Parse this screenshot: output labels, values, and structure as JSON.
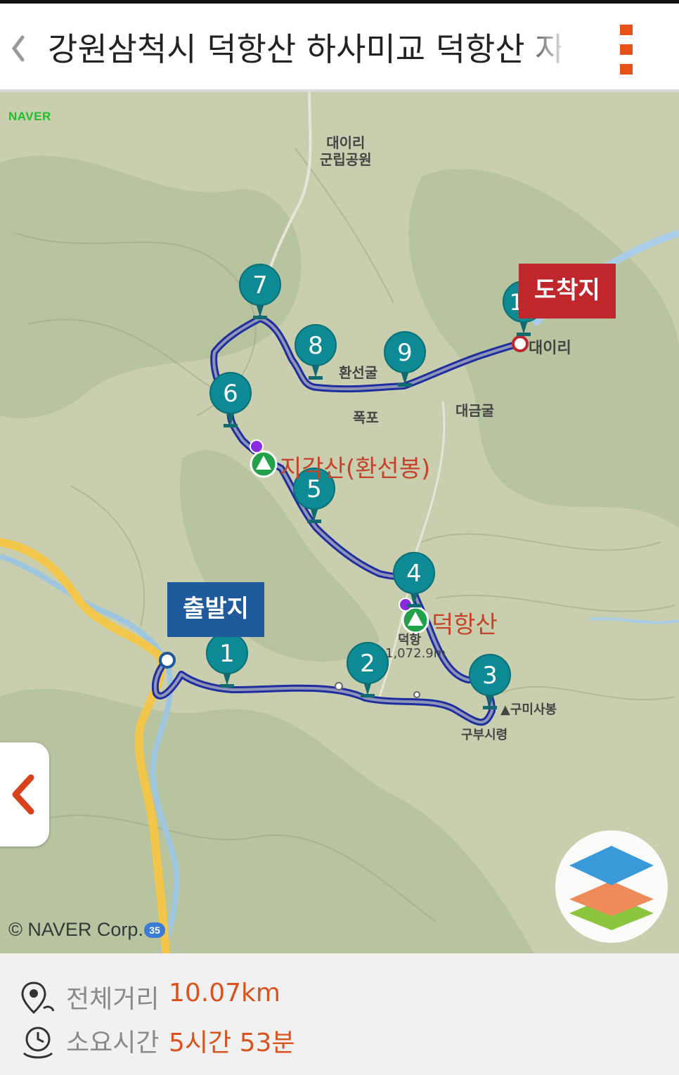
{
  "header": {
    "title": "강원삼척시 덕항산  하사미교 덕항산 자",
    "back_icon": "chevron-left-icon",
    "menu_icon": "vertical-dots-menu-icon",
    "accent": "#e8501a"
  },
  "map": {
    "logo": "NAVER",
    "copyright": "© NAVER Corp.",
    "road_badge": "35",
    "start_label": "출발지",
    "end_label": "도착지",
    "waypoints": [
      "1",
      "2",
      "3",
      "4",
      "5",
      "6",
      "7",
      "8",
      "9",
      "10"
    ],
    "places": {
      "park": "대이리\n군립공원",
      "hwanseongul": "환선굴",
      "pokpo": "폭포",
      "daegeumgul": "대금굴",
      "daeiri": "대이리",
      "gumisabong": "▲구미사봉",
      "gusiryeong": "구부시령",
      "deokhang_small": "덕항",
      "elevation": "1,072.9m"
    },
    "peaks": {
      "jigaksan": "지각산(환선봉)",
      "deokhangsan": "덕항산"
    },
    "route_color": "#1f2e9e",
    "marker_color": "#0d8a93",
    "layers_icon": "layers-icon",
    "side_tab_icon": "chevron-left-icon"
  },
  "footer": {
    "distance_label": "전체거리",
    "distance_value": "10.07km",
    "time_label": "소요시간",
    "time_value": "5시간 53분",
    "distance_icon": "route-pin-icon",
    "time_icon": "clock-icon",
    "value_color": "#d9531e"
  }
}
